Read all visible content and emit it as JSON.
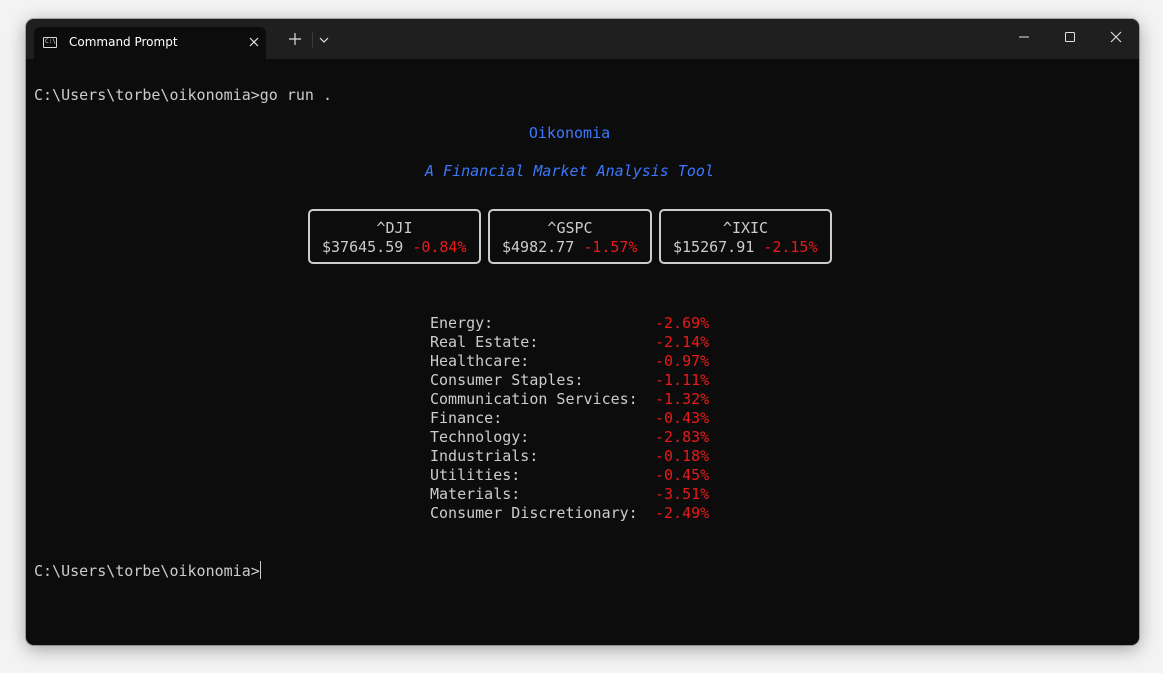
{
  "window": {
    "tab_title": "Command Prompt",
    "tab_icon": "terminal-icon",
    "controls": [
      "minimize-icon",
      "maximize-icon",
      "close-icon"
    ]
  },
  "terminal": {
    "command_line": "C:\\Users\\torbe\\oikonomia>go run .",
    "app_title": "Oikonomia",
    "app_subtitle": "A Financial Market Analysis Tool",
    "indices": [
      {
        "symbol": "^DJI",
        "price": "$37645.59",
        "change": "-0.84%"
      },
      {
        "symbol": "^GSPC",
        "price": "$4982.77",
        "change": "-1.57%"
      },
      {
        "symbol": "^IXIC",
        "price": "$15267.91",
        "change": "-2.15%"
      }
    ],
    "sectors": [
      {
        "name": "Energy:",
        "change": "-2.69%"
      },
      {
        "name": "Real Estate:",
        "change": "-2.14%"
      },
      {
        "name": "Healthcare:",
        "change": "-0.97%"
      },
      {
        "name": "Consumer Staples:",
        "change": "-1.11%"
      },
      {
        "name": "Communication Services:",
        "change": "-1.32%"
      },
      {
        "name": "Finance:",
        "change": "-0.43%"
      },
      {
        "name": "Technology:",
        "change": "-2.83%"
      },
      {
        "name": "Industrials:",
        "change": "-0.18%"
      },
      {
        "name": "Utilities:",
        "change": "-0.45%"
      },
      {
        "name": "Materials:",
        "change": "-3.51%"
      },
      {
        "name": "Consumer Discretionary:",
        "change": "-2.49%"
      }
    ],
    "prompt": "C:\\Users\\torbe\\oikonomia>"
  },
  "colors": {
    "background": "#0c0c0c",
    "text": "#cccccc",
    "accent_blue": "#3b78ff",
    "negative_red": "#e71b1b"
  }
}
